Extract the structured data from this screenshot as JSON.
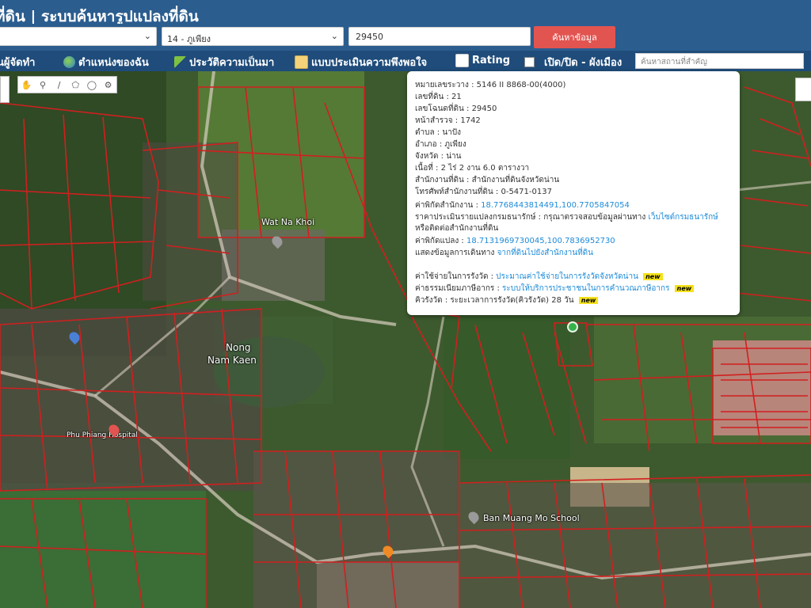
{
  "header": {
    "title": "ที่ดิน | ระบบค้นหารูปแปลงที่ดิน"
  },
  "search": {
    "province_value": "",
    "district_value": "14 - ภูเพียง",
    "parcel_value": "29450",
    "search_button_label": "ค้นหาข้อมูล"
  },
  "menu": {
    "items": [
      {
        "label": "นผู้จัดทำ",
        "icon": "person-icon"
      },
      {
        "label": "ตำแหน่งของฉัน",
        "icon": "globe-icon"
      },
      {
        "label": "ประวัติความเป็นมา",
        "icon": "leaf-icon"
      },
      {
        "label": "แบบประเมินความพึงพอใจ",
        "icon": "form-icon"
      },
      {
        "label": "Rating",
        "icon": "chart-icon"
      },
      {
        "label": "เปิด/ปิด - ผังเมือง",
        "icon": "checkbox"
      }
    ],
    "place_search_placeholder": "ค้นหาสถานที่สำคัญ"
  },
  "map_tools": [
    "hand-icon",
    "pin-icon",
    "line-icon",
    "polygon-icon",
    "circle-icon",
    "gear-icon"
  ],
  "map_labels": {
    "wat": "Wat Na Khoi",
    "pond_line1": "Nong",
    "pond_line2": "Nam Kaen",
    "school": "Ban Muang Mo School",
    "hospital": "Phu Phiang Hospital"
  },
  "popup": {
    "rows": [
      {
        "key": "หมายเลขระวาง",
        "value": "5146 II 8868-00(4000)"
      },
      {
        "key": "เลขที่ดิน",
        "value": "21"
      },
      {
        "key": "เลขโฉนดที่ดิน",
        "value": "29450"
      },
      {
        "key": "หน้าสำรวจ",
        "value": "1742"
      },
      {
        "key": "ตำบล",
        "value": "นาปัง"
      },
      {
        "key": "อำเภอ",
        "value": "ภูเพียง"
      },
      {
        "key": "จังหวัด",
        "value": "น่าน"
      },
      {
        "key": "เนื้อที่",
        "value": "2 ไร่ 2 งาน 6.0 ตารางวา"
      },
      {
        "key": "สำนักงานที่ดิน",
        "value": "สำนักงานที่ดินจังหวัดน่าน"
      },
      {
        "key": "โทรศัพท์สำนักงานที่ดิน",
        "value": "0-5471-0137"
      }
    ],
    "office_coord_label": "ค่าพิกัดสำนักงาน",
    "office_coord_value": "18.7768443814491,100.7705847054",
    "appraisal_prefix": "ราคาประเมินรายแปลงกรมธนารักษ์ : กรุณาตรวจสอบข้อมูลผ่านทาง",
    "appraisal_link": "เว็บไซต์กรมธนารักษ์",
    "appraisal_line2": "หรือติดต่อสำนักงานที่ดิน",
    "parcel_coord_label": "ค่าพิกัดแปลง",
    "parcel_coord_value": "18.7131969730045,100.7836952730",
    "route_prefix": "แสดงข้อมูลการเดินทาง",
    "route_link": "จากที่ดินไปยังสำนักงานที่ดิน",
    "fee_label": "ค่าใช้จ่ายในการรังวัด",
    "fee_link": "ประมาณค่าใช้จ่ายในการรังวัดจังหวัดน่าน",
    "tax_label": "ค่าธรรมเนียมภาษีอากร",
    "tax_link": "ระบบให้บริการประชาชนในการคำนวณภาษีอากร",
    "queue_label": "คิวรังวัด",
    "queue_value": "ระยะเวลาการรังวัด(คิวรังวัด) 28 วัน",
    "new_badge": "new"
  }
}
